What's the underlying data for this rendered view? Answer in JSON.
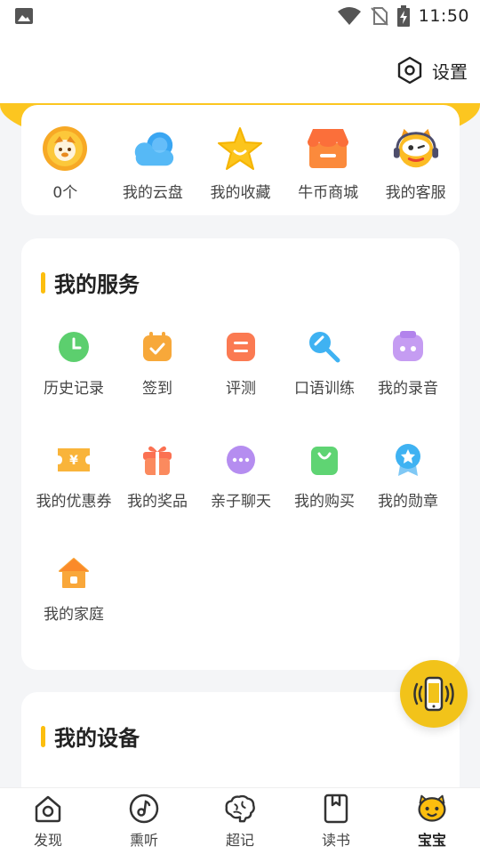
{
  "status_bar": {
    "time": "11:50"
  },
  "header": {
    "settings_label": "设置"
  },
  "quick_actions": [
    {
      "label": "0个",
      "icon": "coin-icon"
    },
    {
      "label": "我的云盘",
      "icon": "cloud-icon"
    },
    {
      "label": "我的收藏",
      "icon": "star-icon"
    },
    {
      "label": "牛币商城",
      "icon": "shop-icon"
    },
    {
      "label": "我的客服",
      "icon": "customer-service-icon"
    }
  ],
  "services": {
    "title": "我的服务",
    "items": [
      {
        "label": "历史记录",
        "icon": "clock-icon",
        "color": "#5ccf6e"
      },
      {
        "label": "签到",
        "icon": "calendar-check-icon",
        "color": "#f7a83a"
      },
      {
        "label": "评测",
        "icon": "evaluation-icon",
        "color": "#fb7a52"
      },
      {
        "label": "口语训练",
        "icon": "microphone-icon",
        "color": "#3fb2f2"
      },
      {
        "label": "我的录音",
        "icon": "recording-icon",
        "color": "#c59cf2"
      },
      {
        "label": "我的优惠券",
        "icon": "coupon-icon",
        "color": "#f9b43a"
      },
      {
        "label": "我的奖品",
        "icon": "gift-icon",
        "color": "#fb7152"
      },
      {
        "label": "亲子聊天",
        "icon": "chat-icon",
        "color": "#b58df0"
      },
      {
        "label": "我的购买",
        "icon": "shopping-bag-icon",
        "color": "#5fd473"
      },
      {
        "label": "我的勋章",
        "icon": "medal-icon",
        "color": "#3fb2f2"
      },
      {
        "label": "我的家庭",
        "icon": "home-icon",
        "color": "#f9a73a"
      }
    ]
  },
  "devices": {
    "title": "我的设备"
  },
  "tabs": [
    {
      "label": "发现",
      "icon": "discover-icon",
      "active": false
    },
    {
      "label": "熏听",
      "icon": "music-note-icon",
      "active": false
    },
    {
      "label": "超记",
      "icon": "brain-icon",
      "active": false
    },
    {
      "label": "读书",
      "icon": "book-icon",
      "active": false
    },
    {
      "label": "宝宝",
      "icon": "baby-icon",
      "active": true
    }
  ],
  "colors": {
    "accent": "#fcc620",
    "title_bar": "#fcbe0e",
    "background": "#f4f5f7"
  }
}
